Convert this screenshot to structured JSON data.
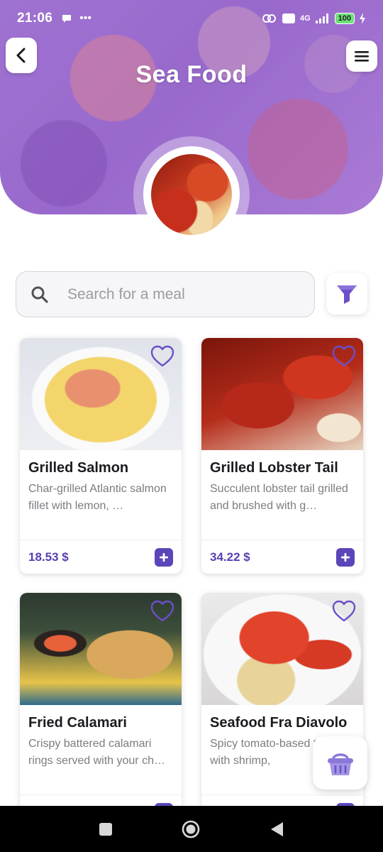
{
  "status_bar": {
    "time": "21:06",
    "network": "4G",
    "battery": "100"
  },
  "header": {
    "title": "Sea Food"
  },
  "search": {
    "placeholder": "Search for a meal"
  },
  "meals": [
    {
      "name": "Grilled Salmon",
      "description": "Char-grilled Atlantic salmon fillet with lemon, …",
      "price": "18.53 $"
    },
    {
      "name": "Grilled Lobster Tail",
      "description": "Succulent lobster tail grilled and brushed with g…",
      "price": "34.22 $"
    },
    {
      "name": "Fried Calamari",
      "description": "Crispy battered calamari rings served with your ch…",
      "price": ""
    },
    {
      "name": "Seafood Fra Diavolo",
      "description": "Spicy tomato-based tossed with shrimp,",
      "price": ""
    }
  ],
  "colors": {
    "accent": "#5b45b8",
    "header": "#a57bd3",
    "price": "#5a3fb0"
  },
  "icons": {
    "back": "chevron-left-icon",
    "menu": "hamburger-menu-icon",
    "search": "search-icon",
    "filter": "filter-icon",
    "favorite": "heart-outline-icon",
    "add": "plus-icon",
    "cart": "basket-icon"
  }
}
